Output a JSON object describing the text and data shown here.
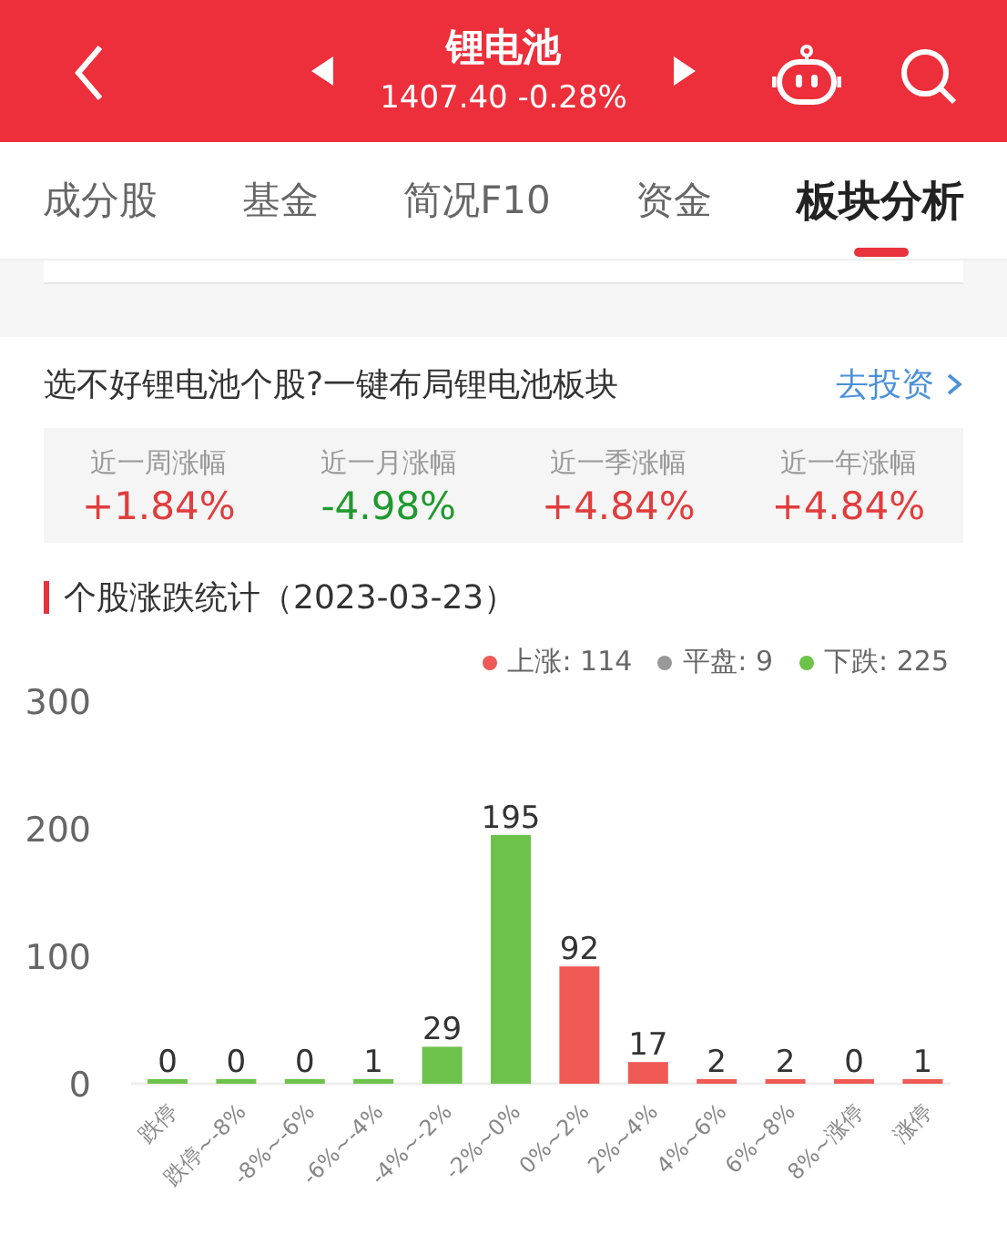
{
  "header": {
    "title": "锂电池",
    "quote": "1407.40 -0.28%"
  },
  "tabs": [
    {
      "label": "成分股",
      "selected": false
    },
    {
      "label": "基金",
      "selected": false
    },
    {
      "label": "简况F10",
      "selected": false
    },
    {
      "label": "资金",
      "selected": false
    },
    {
      "label": "板块分析",
      "selected": true
    }
  ],
  "promo": {
    "text": "选不好锂电池个股?一键布局锂电池板块",
    "link": "去投资"
  },
  "returns": [
    {
      "label": "近一周涨幅",
      "value": "+1.84%",
      "kind": "up"
    },
    {
      "label": "近一月涨幅",
      "value": "-4.98%",
      "kind": "down"
    },
    {
      "label": "近一季涨幅",
      "value": "+4.84%",
      "kind": "up"
    },
    {
      "label": "近一年涨幅",
      "value": "+4.84%",
      "kind": "up"
    }
  ],
  "section_title": "个股涨跌统计（2023-03-23）",
  "legend": [
    {
      "label": "上涨: 114",
      "color": "#ef5a55"
    },
    {
      "label": "平盘: 9",
      "color": "#999999"
    },
    {
      "label": "下跌: 225",
      "color": "#6cc24a"
    }
  ],
  "chart_data": {
    "type": "bar",
    "categories": [
      "跌停",
      "跌停~-8%",
      "-8%~-6%",
      "-6%~-4%",
      "-4%~-2%",
      "-2%~0%",
      "0%~2%",
      "2%~4%",
      "4%~6%",
      "6%~8%",
      "8%~涨停",
      "涨停"
    ],
    "series": [
      {
        "color": "#6cc24a",
        "values": [
          0,
          0,
          0,
          1,
          29,
          195,
          null,
          null,
          null,
          null,
          null,
          null
        ]
      },
      {
        "color": "#ef5a55",
        "values": [
          null,
          null,
          null,
          null,
          null,
          null,
          92,
          17,
          2,
          2,
          0,
          1
        ]
      }
    ],
    "ylim": [
      0,
      300
    ],
    "yticks": [
      0,
      100,
      200,
      300
    ],
    "data_labels": true
  }
}
